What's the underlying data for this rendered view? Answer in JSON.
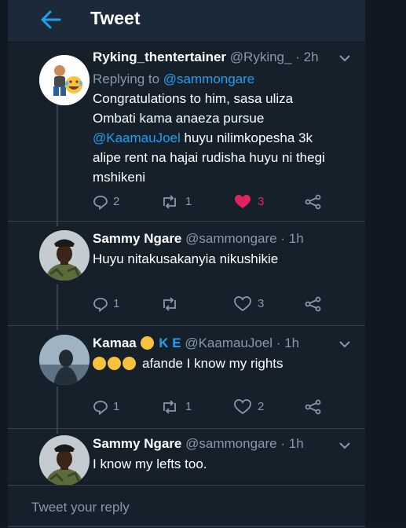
{
  "header": {
    "title": "Tweet"
  },
  "tweets": [
    {
      "name": "Ryking_thentertainer",
      "handle": "@Ryking_",
      "sep": "·",
      "time": "2h",
      "replying_label": "Replying to",
      "replying_handle": "@sammongare",
      "text_1": "Congratulations to him, sasa uliza",
      "text_2": "Ombati kama anaeza pursue",
      "mention": "@KaamauJoel",
      "text_3": " huyu nilimkopesha 3k",
      "text_4": "alipe rent na hajai rudisha huyu ni thegi",
      "text_5": "mshikeni",
      "replies": "2",
      "retweets": "1",
      "likes": "3",
      "liked": true
    },
    {
      "name": "Sammy Ngare",
      "handle": "@sammongare",
      "sep": "·",
      "time": "1h",
      "text_1": "Huyu nitakusakanyia nikushikie",
      "replies": "1",
      "retweets": "",
      "likes": "3",
      "liked": false
    },
    {
      "name": "Kamaa",
      "name_suffix": "K E",
      "handle": "@KaamauJoel",
      "sep": "·",
      "time": "1h",
      "text_1": "afande I know my rights",
      "replies": "1",
      "retweets": "1",
      "likes": "2",
      "liked": false
    },
    {
      "name": "Sammy Ngare",
      "handle": "@sammongare",
      "sep": "·",
      "time": "1h",
      "text_1": "I know my lefts too."
    }
  ],
  "reply_box": {
    "placeholder": "Tweet your reply"
  },
  "colors": {
    "accent": "#1da1f2",
    "like": "#e0245e",
    "muted": "#8899a6",
    "bg": "#15202b"
  },
  "icons": [
    "back-arrow-icon",
    "chevron-down-icon",
    "reply-icon",
    "retweet-icon",
    "heart-icon",
    "share-icon"
  ]
}
